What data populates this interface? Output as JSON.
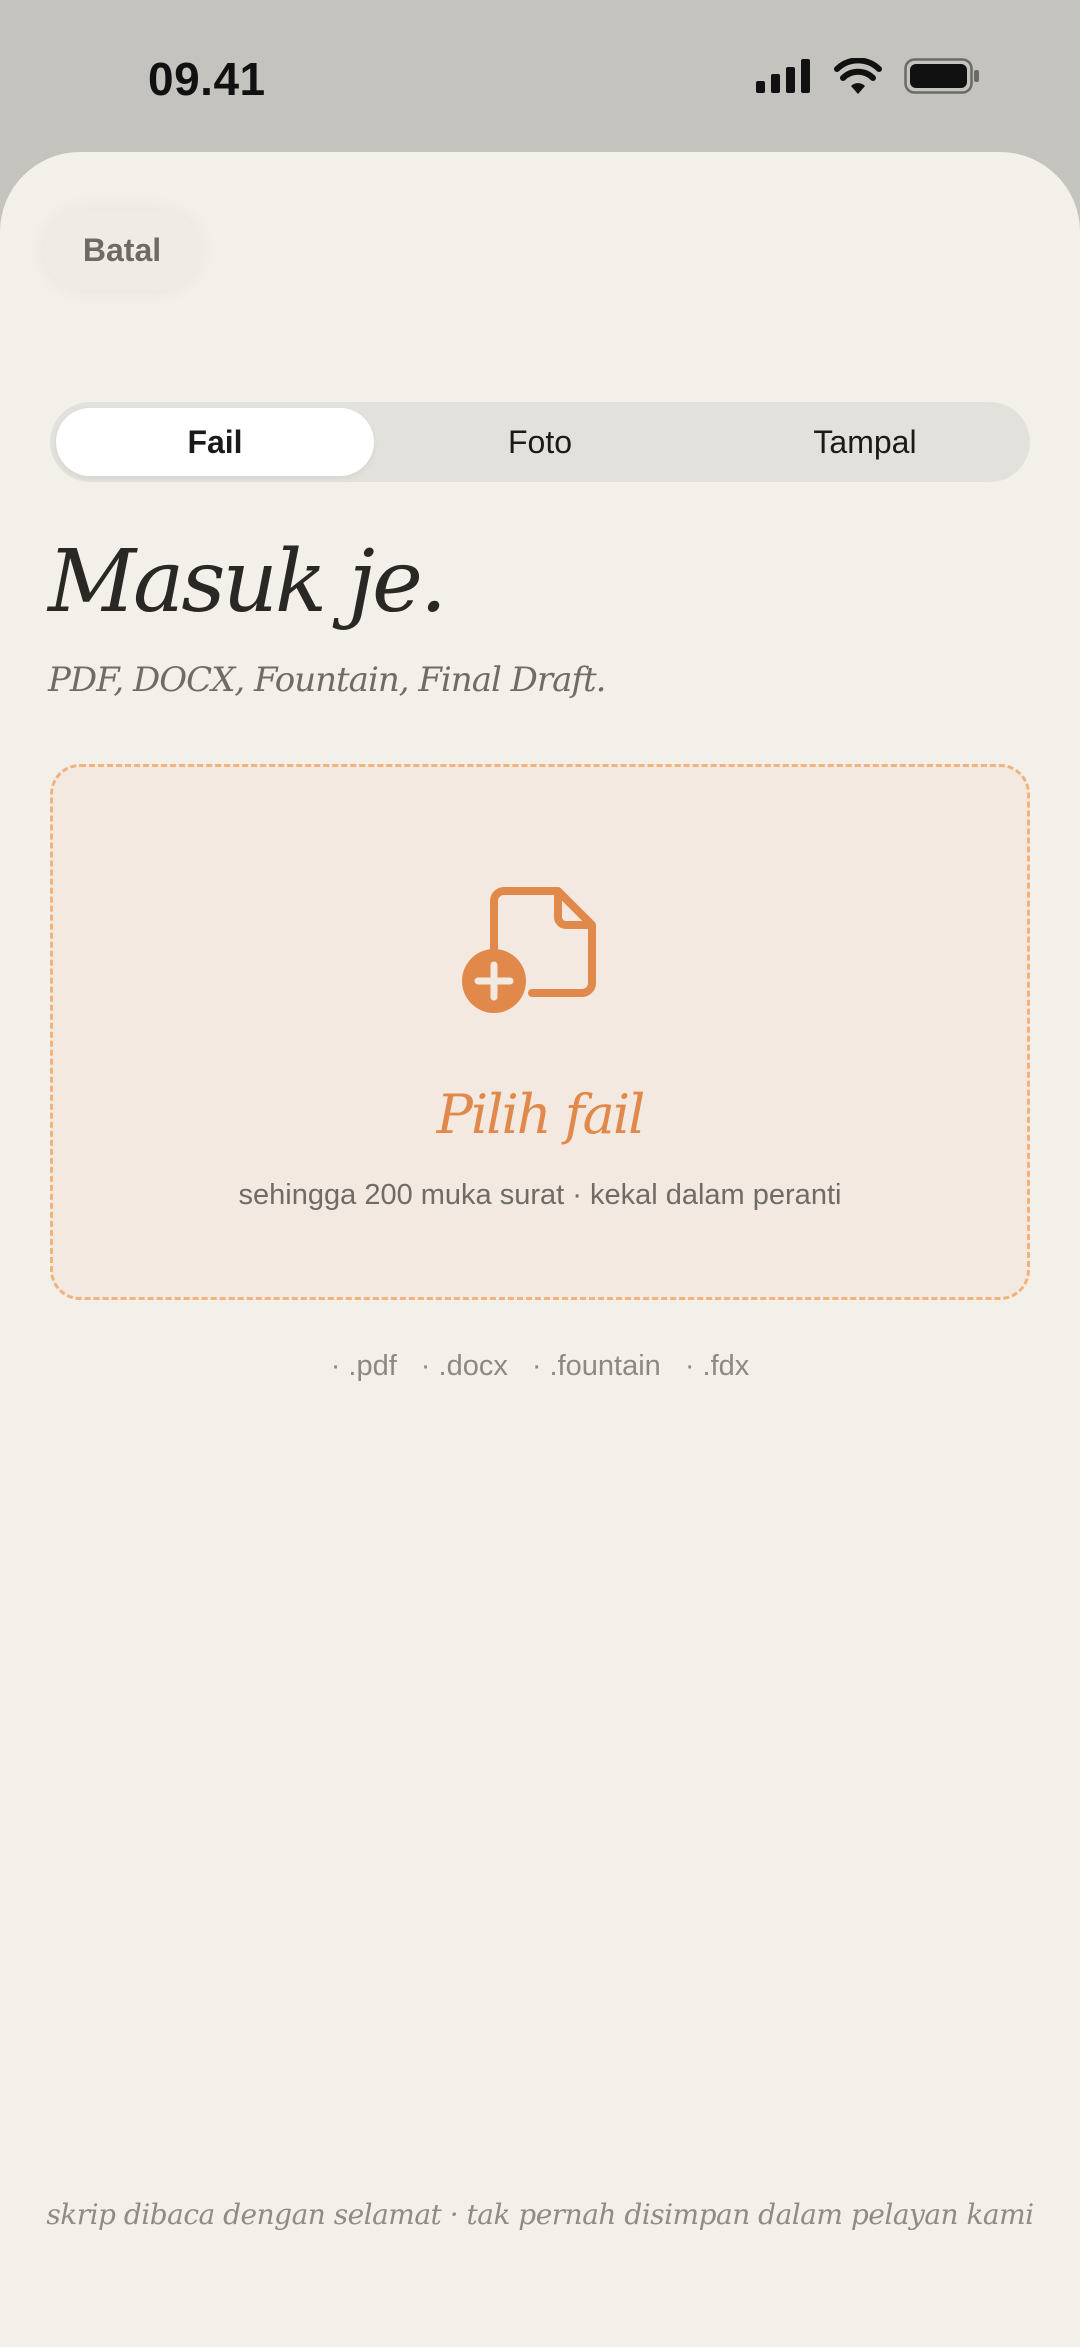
{
  "status_bar": {
    "time": "09.41",
    "icons": [
      "cellular-signal-icon",
      "wifi-icon",
      "battery-icon"
    ]
  },
  "header": {
    "cancel_label": "Batal"
  },
  "tabs": [
    {
      "label": "Fail",
      "selected": true
    },
    {
      "label": "Foto",
      "selected": false
    },
    {
      "label": "Tampal",
      "selected": false
    }
  ],
  "main": {
    "title": "Masuk je.",
    "subtitle": "PDF, DOCX, Fountain, Final Draft."
  },
  "dropzone": {
    "icon": "file-add-icon",
    "title": "Pilih fail",
    "description": "sehingga 200 muka surat · kekal dalam peranti"
  },
  "formats": [
    "· .pdf",
    "· .docx",
    "· .fountain",
    "· .fdx"
  ],
  "footer": {
    "note": "skrip dibaca dengan selamat · tak pernah disimpan dalam pelayan kami"
  },
  "colors": {
    "accent": "#e0894a",
    "sheet_background": "#f3f0ea",
    "dropzone_border": "#f0b37e",
    "dropzone_background": "#f3e9e0"
  }
}
